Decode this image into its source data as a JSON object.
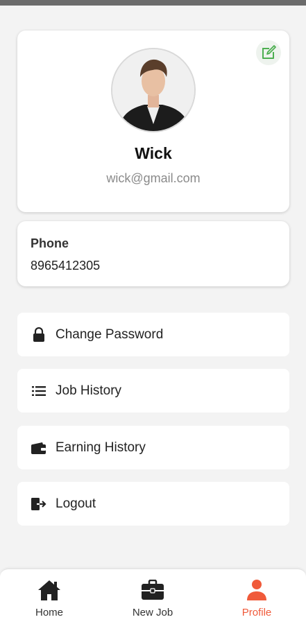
{
  "profile": {
    "name": "Wick",
    "email": "wick@gmail.com"
  },
  "contact": {
    "phone_label": "Phone",
    "phone_value": "8965412305"
  },
  "menu": [
    {
      "label": "Change Password",
      "icon": "lock-icon"
    },
    {
      "label": "Job History",
      "icon": "list-icon"
    },
    {
      "label": "Earning History",
      "icon": "wallet-icon"
    },
    {
      "label": "Logout",
      "icon": "logout-icon"
    }
  ],
  "nav": [
    {
      "label": "Home",
      "icon": "home-icon"
    },
    {
      "label": "New Job",
      "icon": "briefcase-icon"
    },
    {
      "label": "Profile",
      "icon": "person-icon",
      "active": true
    }
  ],
  "colors": {
    "accent": "#f05a3a",
    "edit": "#4caf50"
  }
}
